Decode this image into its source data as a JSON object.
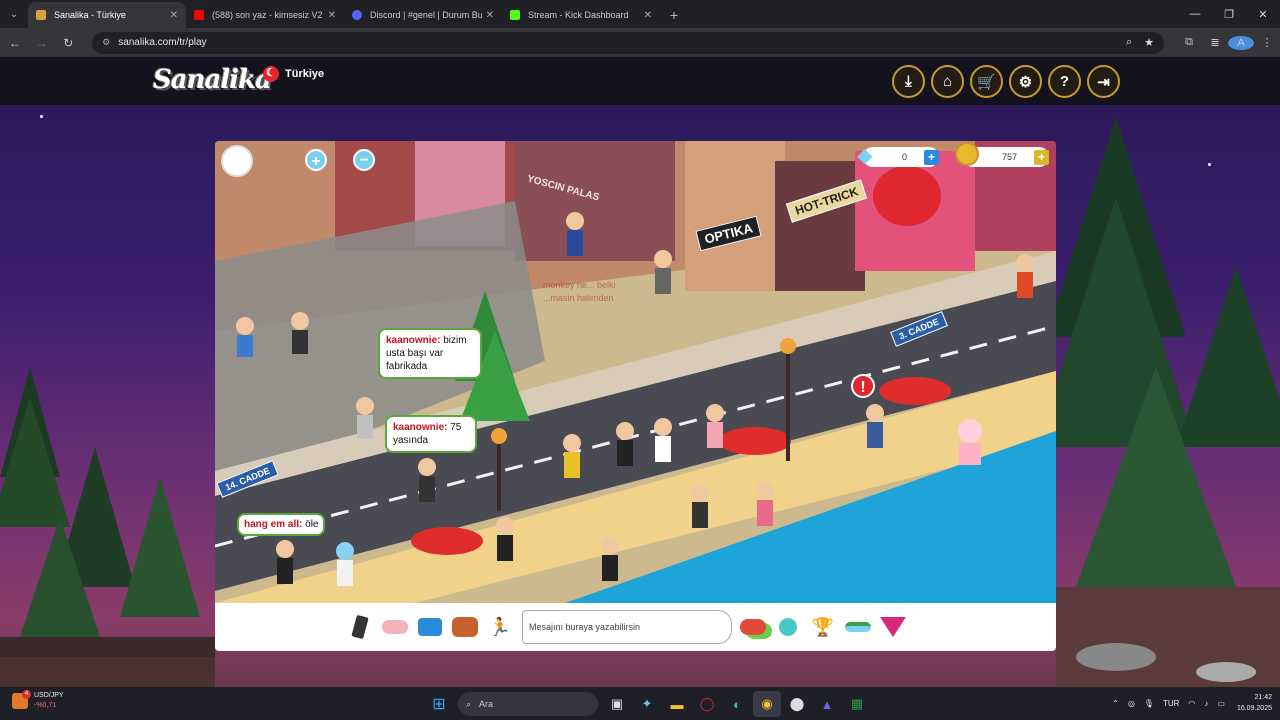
{
  "browser": {
    "tabs": [
      {
        "title": "Sanalika - Türkiye",
        "color": "#d9a13a",
        "active": true
      },
      {
        "title": "(588) son yaz - kimsesiz V2 (slo",
        "color": "#ff0000",
        "active": false
      },
      {
        "title": "Discord | #genel | Durum Bu",
        "color": "#5865f2",
        "active": false
      },
      {
        "title": "Stream - Kick Dashboard",
        "color": "#53fc18",
        "active": false
      }
    ],
    "url": "sanalika.com/tr/play"
  },
  "site": {
    "logo": "Sanalika",
    "region": "Türkiye",
    "header_buttons": [
      {
        "name": "download-icon",
        "glyph": "⤓"
      },
      {
        "name": "home-icon",
        "glyph": "⌂"
      },
      {
        "name": "cart-icon",
        "glyph": "🛒"
      },
      {
        "name": "gear-icon",
        "glyph": "⚙"
      },
      {
        "name": "help-icon",
        "glyph": "?"
      },
      {
        "name": "logout-icon",
        "glyph": "⇥"
      }
    ]
  },
  "game": {
    "diamonds": "0",
    "coins": "757",
    "chat": [
      {
        "user": "kaanownie:",
        "text": " bizim usta başı var fabrikada"
      },
      {
        "user": "kaanownie:",
        "text": " 75 yasında"
      },
      {
        "user": "hang em all:",
        "text": " öle"
      }
    ],
    "faded_chat": [
      "monkey ne... belki",
      "...masin halimden"
    ],
    "street_signs": [
      "3. CADDE",
      "14. CADDE"
    ],
    "shop_signs": [
      "YOSCIN PALAS",
      "OPTIKA",
      "HOT-TRICK"
    ],
    "chat_placeholder": "Mesajını buraya yazabilirsin",
    "toolbar_left": [
      "phone-icon",
      "gestures-icon",
      "outfit-icon",
      "inventory-icon",
      "dance-icon"
    ],
    "toolbar_right": [
      "chat-icon",
      "pet-icon",
      "trophy-icon",
      "island-icon",
      "gem-icon"
    ]
  },
  "taskbar": {
    "widget_title": "USD/JPY",
    "widget_value": "-%0,71",
    "widget_badge": "4",
    "search": "Ara",
    "lang": "TUR",
    "time": "21:42",
    "date": "16.09.2025"
  }
}
